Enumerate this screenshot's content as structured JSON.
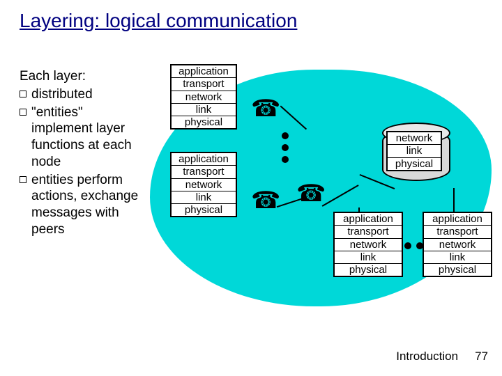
{
  "title": "Layering: logical communication",
  "bullets": {
    "lead": "Each layer:",
    "items": [
      "distributed",
      "\"entities\" implement layer functions at each node",
      "entities perform actions, exchange messages with peers"
    ]
  },
  "stacks": {
    "full": [
      "application",
      "transport",
      "network",
      "link",
      "physical"
    ],
    "three": [
      "network",
      "link",
      "physical"
    ]
  },
  "footer": {
    "section": "Introduction",
    "page": "77"
  }
}
